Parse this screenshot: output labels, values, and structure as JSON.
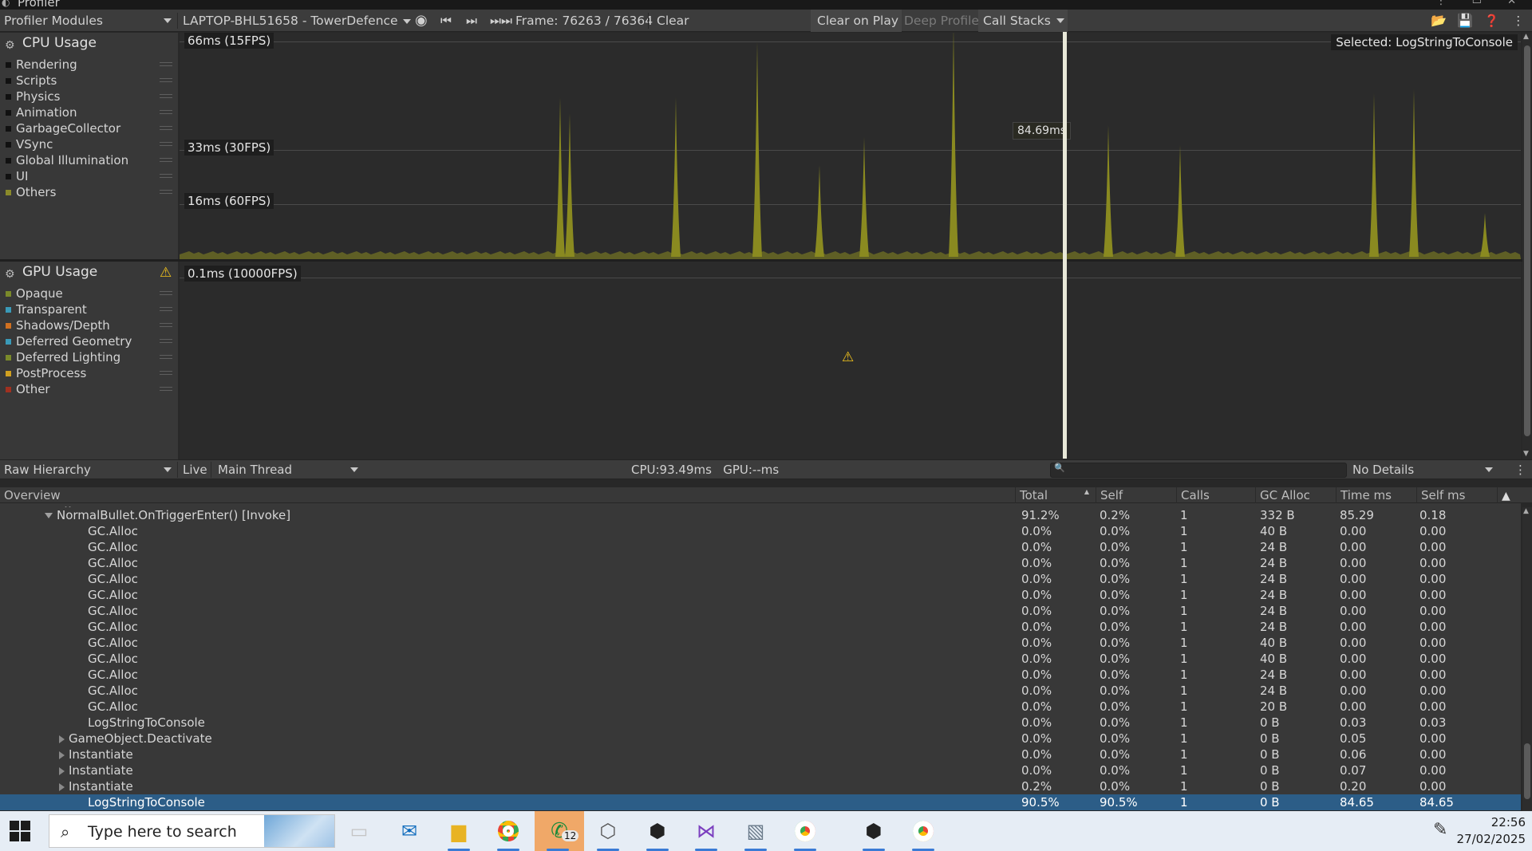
{
  "window": {
    "title": "Profiler"
  },
  "toolbar": {
    "modules_label": "Profiler Modules",
    "target_label": "LAPTOP-BHL51658 - TowerDefence",
    "frame_label": "Frame: 76263 / 76364",
    "clear_label": "Clear",
    "clear_on_play_label": "Clear on Play",
    "deep_profile_label": "Deep Profile",
    "call_stacks_label": "Call Stacks"
  },
  "cpu": {
    "title": "CPU Usage",
    "legend": [
      {
        "label": "Rendering",
        "color": "#111111"
      },
      {
        "label": "Scripts",
        "color": "#111111"
      },
      {
        "label": "Physics",
        "color": "#111111"
      },
      {
        "label": "Animation",
        "color": "#111111"
      },
      {
        "label": "GarbageCollector",
        "color": "#111111"
      },
      {
        "label": "VSync",
        "color": "#111111"
      },
      {
        "label": "Global Illumination",
        "color": "#111111"
      },
      {
        "label": "UI",
        "color": "#111111"
      },
      {
        "label": "Others",
        "color": "#8a8a2a"
      }
    ],
    "grid_labels": [
      "66ms (15FPS)",
      "33ms (30FPS)",
      "16ms (60FPS)"
    ],
    "selected_label": "Selected: LogStringToConsole",
    "cursor_value": "84.69ms"
  },
  "gpu": {
    "title": "GPU Usage",
    "legend": [
      {
        "label": "Opaque",
        "color": "#7a8a2a"
      },
      {
        "label": "Transparent",
        "color": "#3a9ab8"
      },
      {
        "label": "Shadows/Depth",
        "color": "#d07020"
      },
      {
        "label": "Deferred Geometry",
        "color": "#3a9ab8"
      },
      {
        "label": "Deferred Lighting",
        "color": "#7a8a2a"
      },
      {
        "label": "PostProcess",
        "color": "#d0a020"
      },
      {
        "label": "Other",
        "color": "#a03020"
      }
    ],
    "grid_label": "0.1ms (10000FPS)"
  },
  "details": {
    "view_label": "Raw Hierarchy",
    "live_label": "Live",
    "thread_label": "Main Thread",
    "stats": "CPU:93.49ms   GPU:--ms",
    "no_details_label": "No Details"
  },
  "table": {
    "headers": [
      "Overview",
      "Total",
      "Self",
      "Calls",
      "GC Alloc",
      "Time ms",
      "Self ms"
    ],
    "rows": [
      {
        "name": "NormalBullet.OnTriggerEnter() [Invoke]",
        "indent": 1,
        "expander": "down",
        "total": "91.2%",
        "self": "0.2%",
        "calls": "1",
        "gc": "332 B",
        "time": "85.29",
        "selfms": "0.18"
      },
      {
        "name": "GC.Alloc",
        "indent": 2,
        "expander": "",
        "total": "0.0%",
        "self": "0.0%",
        "calls": "1",
        "gc": "40 B",
        "time": "0.00",
        "selfms": "0.00"
      },
      {
        "name": "GC.Alloc",
        "indent": 2,
        "expander": "",
        "total": "0.0%",
        "self": "0.0%",
        "calls": "1",
        "gc": "24 B",
        "time": "0.00",
        "selfms": "0.00"
      },
      {
        "name": "GC.Alloc",
        "indent": 2,
        "expander": "",
        "total": "0.0%",
        "self": "0.0%",
        "calls": "1",
        "gc": "24 B",
        "time": "0.00",
        "selfms": "0.00"
      },
      {
        "name": "GC.Alloc",
        "indent": 2,
        "expander": "",
        "total": "0.0%",
        "self": "0.0%",
        "calls": "1",
        "gc": "24 B",
        "time": "0.00",
        "selfms": "0.00"
      },
      {
        "name": "GC.Alloc",
        "indent": 2,
        "expander": "",
        "total": "0.0%",
        "self": "0.0%",
        "calls": "1",
        "gc": "24 B",
        "time": "0.00",
        "selfms": "0.00"
      },
      {
        "name": "GC.Alloc",
        "indent": 2,
        "expander": "",
        "total": "0.0%",
        "self": "0.0%",
        "calls": "1",
        "gc": "24 B",
        "time": "0.00",
        "selfms": "0.00"
      },
      {
        "name": "GC.Alloc",
        "indent": 2,
        "expander": "",
        "total": "0.0%",
        "self": "0.0%",
        "calls": "1",
        "gc": "24 B",
        "time": "0.00",
        "selfms": "0.00"
      },
      {
        "name": "GC.Alloc",
        "indent": 2,
        "expander": "",
        "total": "0.0%",
        "self": "0.0%",
        "calls": "1",
        "gc": "40 B",
        "time": "0.00",
        "selfms": "0.00"
      },
      {
        "name": "GC.Alloc",
        "indent": 2,
        "expander": "",
        "total": "0.0%",
        "self": "0.0%",
        "calls": "1",
        "gc": "40 B",
        "time": "0.00",
        "selfms": "0.00"
      },
      {
        "name": "GC.Alloc",
        "indent": 2,
        "expander": "",
        "total": "0.0%",
        "self": "0.0%",
        "calls": "1",
        "gc": "24 B",
        "time": "0.00",
        "selfms": "0.00"
      },
      {
        "name": "GC.Alloc",
        "indent": 2,
        "expander": "",
        "total": "0.0%",
        "self": "0.0%",
        "calls": "1",
        "gc": "24 B",
        "time": "0.00",
        "selfms": "0.00"
      },
      {
        "name": "GC.Alloc",
        "indent": 2,
        "expander": "",
        "total": "0.0%",
        "self": "0.0%",
        "calls": "1",
        "gc": "20 B",
        "time": "0.00",
        "selfms": "0.00"
      },
      {
        "name": "LogStringToConsole",
        "indent": 2,
        "expander": "",
        "total": "0.0%",
        "self": "0.0%",
        "calls": "1",
        "gc": "0 B",
        "time": "0.03",
        "selfms": "0.03"
      },
      {
        "name": "GameObject.Deactivate",
        "indent": 2,
        "expander": "right",
        "total": "0.0%",
        "self": "0.0%",
        "calls": "1",
        "gc": "0 B",
        "time": "0.05",
        "selfms": "0.00"
      },
      {
        "name": "Instantiate",
        "indent": 2,
        "expander": "right",
        "total": "0.0%",
        "self": "0.0%",
        "calls": "1",
        "gc": "0 B",
        "time": "0.06",
        "selfms": "0.00"
      },
      {
        "name": "Instantiate",
        "indent": 2,
        "expander": "right",
        "total": "0.0%",
        "self": "0.0%",
        "calls": "1",
        "gc": "0 B",
        "time": "0.07",
        "selfms": "0.00"
      },
      {
        "name": "Instantiate",
        "indent": 2,
        "expander": "right",
        "total": "0.2%",
        "self": "0.0%",
        "calls": "1",
        "gc": "0 B",
        "time": "0.20",
        "selfms": "0.00"
      },
      {
        "name": "LogStringToConsole",
        "indent": 2,
        "expander": "",
        "total": "90.5%",
        "self": "90.5%",
        "calls": "1",
        "gc": "0 B",
        "time": "84.65",
        "selfms": "84.65",
        "selected": true
      }
    ]
  },
  "taskbar": {
    "search_placeholder": "Type here to search",
    "time": "22:56",
    "date": "27/02/2025",
    "whatsapp_badge": "12",
    "icons": [
      "task-view-icon",
      "outlook-icon",
      "file-explorer-icon",
      "chrome-icon",
      "whatsapp-icon",
      "unity-hub-icon",
      "unity-icon",
      "visual-studio-icon",
      "photos-icon",
      "chrome-profile-icon",
      "unity-editor-icon",
      "chrome-profile-r-icon"
    ]
  },
  "colors": {
    "accent_selected_row": "#2c5d87",
    "cpu_spike": "#8a8a20"
  }
}
